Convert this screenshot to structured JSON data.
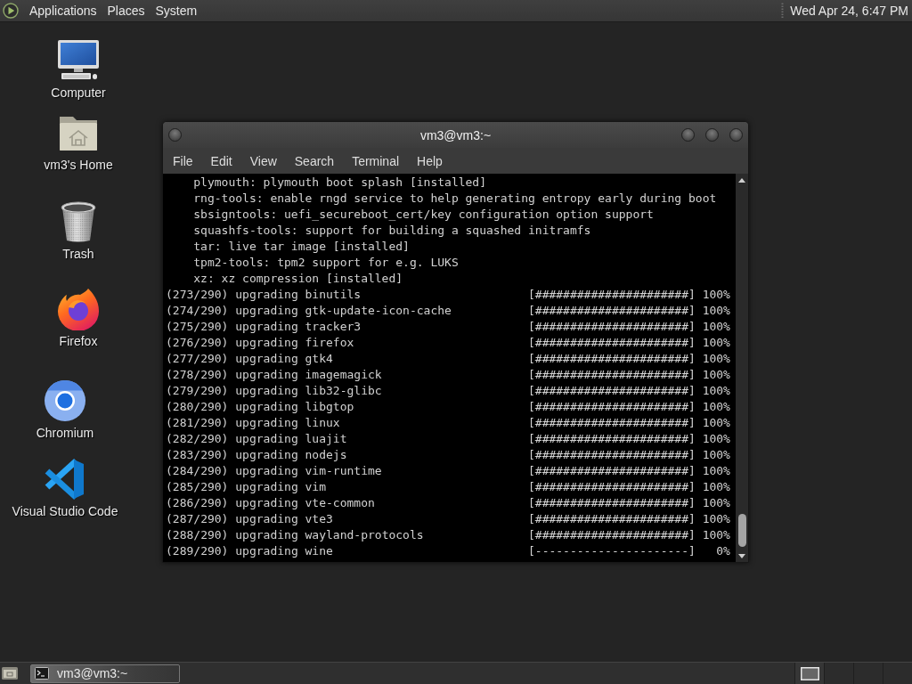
{
  "top_panel": {
    "menus": [
      "Applications",
      "Places",
      "System"
    ],
    "clock": "Wed Apr 24, 6:47 PM"
  },
  "desktop_icons": [
    {
      "label": "Computer",
      "kind": "computer"
    },
    {
      "label": "vm3's Home",
      "kind": "home"
    },
    {
      "label": "Trash",
      "kind": "trash"
    },
    {
      "label": "Firefox",
      "kind": "firefox"
    },
    {
      "label": "Chromium",
      "kind": "chromium"
    },
    {
      "label": "Visual Studio Code",
      "kind": "vscode"
    }
  ],
  "terminal": {
    "title": "vm3@vm3:~",
    "menu": [
      "File",
      "Edit",
      "View",
      "Search",
      "Terminal",
      "Help"
    ],
    "lines": [
      {
        "kind": "note",
        "text": "plymouth: plymouth boot splash [installed]"
      },
      {
        "kind": "note",
        "text": "rng-tools: enable rngd service to help generating entropy early during boot"
      },
      {
        "kind": "note",
        "text": "sbsigntools: uefi_secureboot_cert/key configuration option support"
      },
      {
        "kind": "note",
        "text": "squashfs-tools: support for building a squashed initramfs"
      },
      {
        "kind": "note",
        "text": "tar: live tar image [installed]"
      },
      {
        "kind": "note",
        "text": "tpm2-tools: tpm2 support for e.g. LUKS"
      },
      {
        "kind": "note",
        "text": "xz: xz compression [installed]"
      },
      {
        "kind": "progress",
        "text": "(273/290) upgrading binutils",
        "bar": "[######################]",
        "percent": "100%"
      },
      {
        "kind": "progress",
        "text": "(274/290) upgrading gtk-update-icon-cache",
        "bar": "[######################]",
        "percent": "100%"
      },
      {
        "kind": "progress",
        "text": "(275/290) upgrading tracker3",
        "bar": "[######################]",
        "percent": "100%"
      },
      {
        "kind": "progress",
        "text": "(276/290) upgrading firefox",
        "bar": "[######################]",
        "percent": "100%"
      },
      {
        "kind": "progress",
        "text": "(277/290) upgrading gtk4",
        "bar": "[######################]",
        "percent": "100%"
      },
      {
        "kind": "progress",
        "text": "(278/290) upgrading imagemagick",
        "bar": "[######################]",
        "percent": "100%"
      },
      {
        "kind": "progress",
        "text": "(279/290) upgrading lib32-glibc",
        "bar": "[######################]",
        "percent": "100%"
      },
      {
        "kind": "progress",
        "text": "(280/290) upgrading libgtop",
        "bar": "[######################]",
        "percent": "100%"
      },
      {
        "kind": "progress",
        "text": "(281/290) upgrading linux",
        "bar": "[######################]",
        "percent": "100%"
      },
      {
        "kind": "progress",
        "text": "(282/290) upgrading luajit",
        "bar": "[######################]",
        "percent": "100%"
      },
      {
        "kind": "progress",
        "text": "(283/290) upgrading nodejs",
        "bar": "[######################]",
        "percent": "100%"
      },
      {
        "kind": "progress",
        "text": "(284/290) upgrading vim-runtime",
        "bar": "[######################]",
        "percent": "100%"
      },
      {
        "kind": "progress",
        "text": "(285/290) upgrading vim",
        "bar": "[######################]",
        "percent": "100%"
      },
      {
        "kind": "progress",
        "text": "(286/290) upgrading vte-common",
        "bar": "[######################]",
        "percent": "100%"
      },
      {
        "kind": "progress",
        "text": "(287/290) upgrading vte3",
        "bar": "[######################]",
        "percent": "100%"
      },
      {
        "kind": "progress",
        "text": "(288/290) upgrading wayland-protocols",
        "bar": "[######################]",
        "percent": "100%"
      },
      {
        "kind": "progress",
        "text": "(289/290) upgrading wine",
        "bar": "[----------------------]",
        "percent": "0%"
      }
    ]
  },
  "taskbar": {
    "tasks": [
      {
        "label": "vm3@vm3:~",
        "selected": true
      }
    ],
    "workspaces": [
      {
        "selected": true
      },
      {
        "selected": false
      },
      {
        "selected": false
      },
      {
        "selected": false
      }
    ]
  }
}
